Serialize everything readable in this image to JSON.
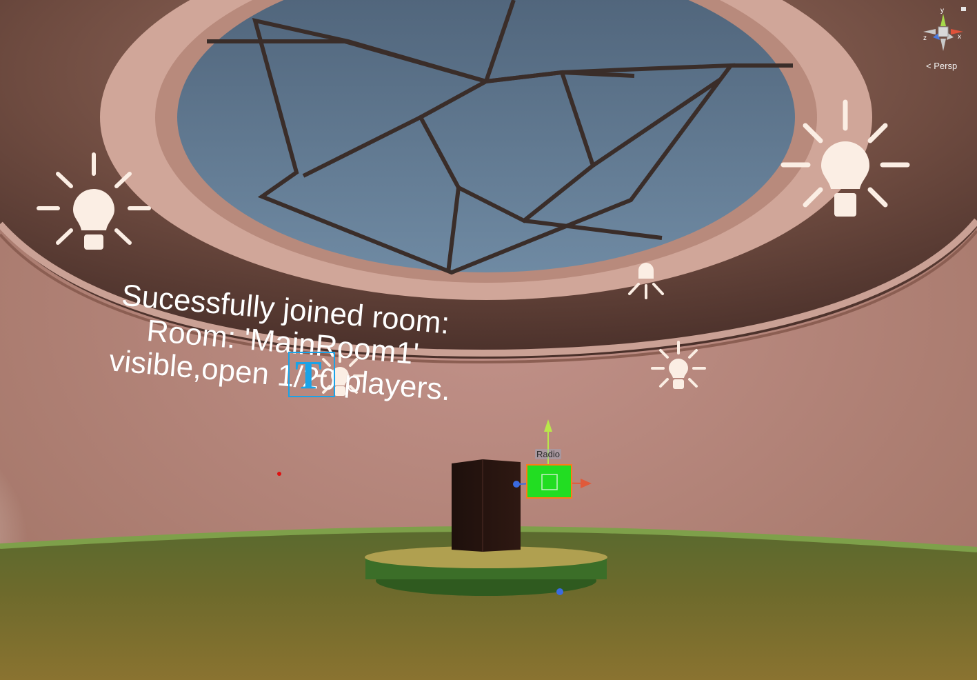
{
  "scene": {
    "world_text_lines": [
      "Sucessfully joined room:",
      "Room: 'MainRoom1'",
      "visible,open 1/20 players."
    ],
    "selected_object_label": "Radio",
    "text_component_icon": "T"
  },
  "scene_gizmo": {
    "axis_y": "y",
    "axis_x": "x",
    "axis_z": "z",
    "projection_label": "Persp",
    "icon": "scene-orientation-gizmo"
  },
  "colors": {
    "sky": "#5b7187",
    "wall": "#b88879",
    "floor": "#6b6a30",
    "selection_green": "#22dd22",
    "selection_outline": "#ff7a1a",
    "text_gizmo_blue": "#1aa3e8"
  }
}
